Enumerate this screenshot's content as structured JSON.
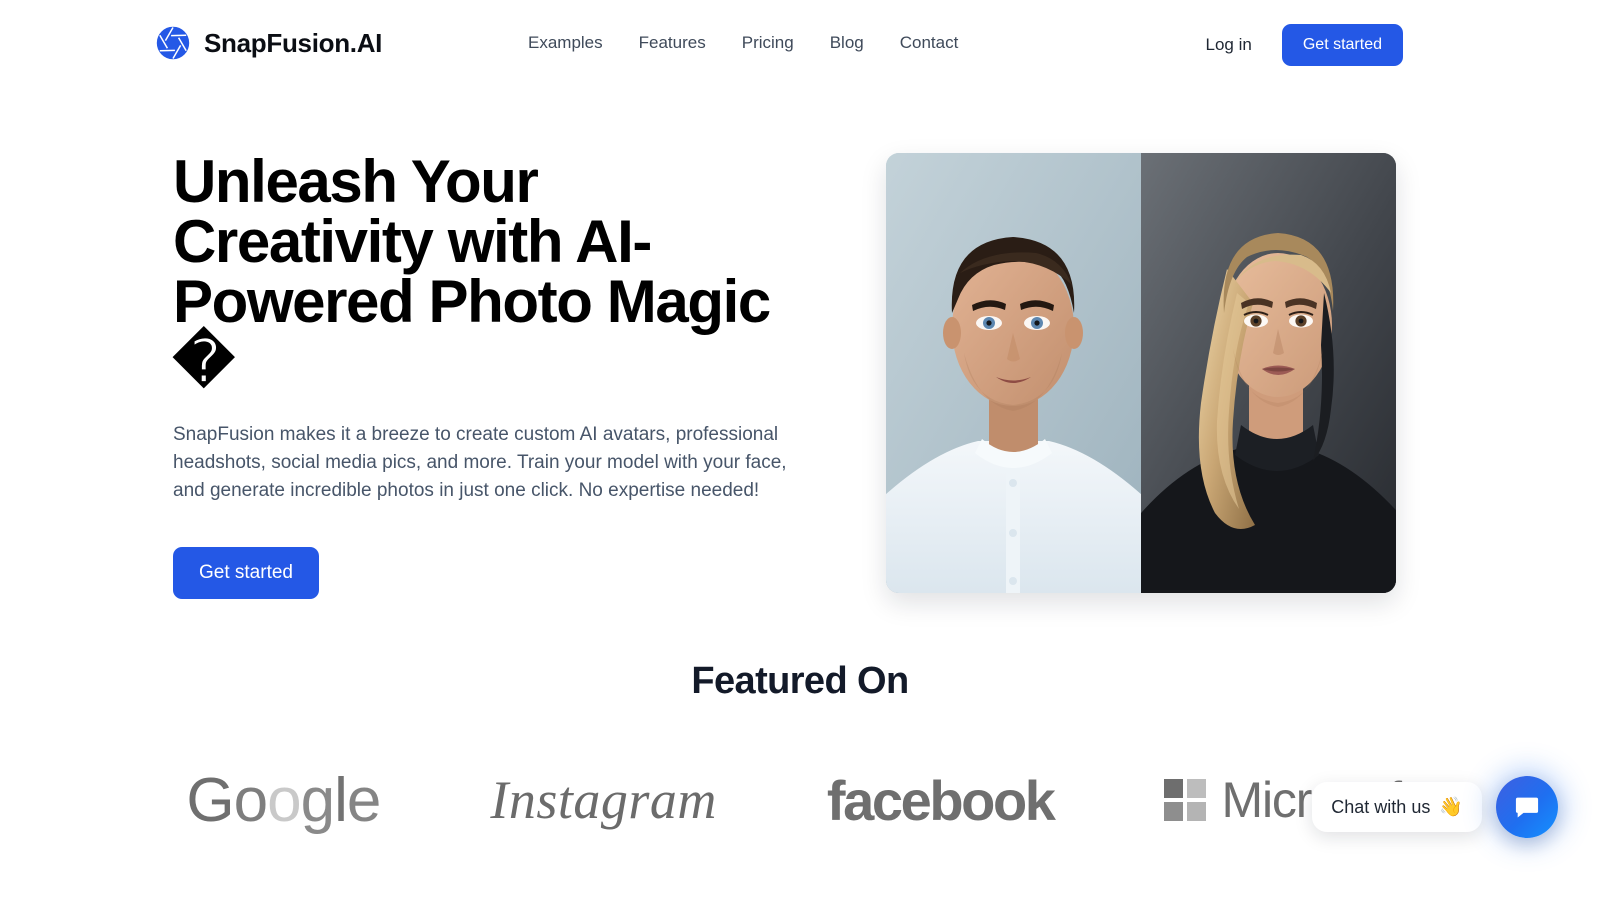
{
  "header": {
    "brand_name": "SnapFusion.AI",
    "logo_icon": "camera-aperture-icon",
    "nav": [
      {
        "label": "Examples"
      },
      {
        "label": "Features"
      },
      {
        "label": "Pricing"
      },
      {
        "label": "Blog"
      },
      {
        "label": "Contact"
      }
    ],
    "login_label": "Log in",
    "get_started_label": "Get started"
  },
  "hero": {
    "title": "Unleash Your Creativity with AI-Powered Photo Magic �",
    "subtitle": "SnapFusion makes it a breeze to create custom AI avatars, professional headshots, social media pics, and more. Train your model with your face, and generate incredible photos in just one click. No expertise needed!",
    "cta_label": "Get started",
    "media": {
      "left_alt": "AI generated portrait of a man in a light blue collarless shirt",
      "right_alt": "AI generated portrait of a woman with blonde hair in a black turtleneck"
    }
  },
  "featured": {
    "title": "Featured On",
    "logos": [
      {
        "name": "Google",
        "letters": [
          "G",
          "o",
          "o",
          "g",
          "l",
          "e"
        ]
      },
      {
        "name": "Instagram"
      },
      {
        "name": "facebook"
      },
      {
        "name": "Microsoft"
      }
    ]
  },
  "chat": {
    "message": "Chat with us",
    "wave_emoji": "👋",
    "launcher_icon": "chat-bubble-icon"
  },
  "colors": {
    "accent_blue": "#2458e6",
    "nav_text": "#3f4a5a",
    "body_text": "#475569",
    "heading_dark": "#131a29",
    "logo_gray": "#6f6f6f",
    "background": "#ffffff"
  }
}
